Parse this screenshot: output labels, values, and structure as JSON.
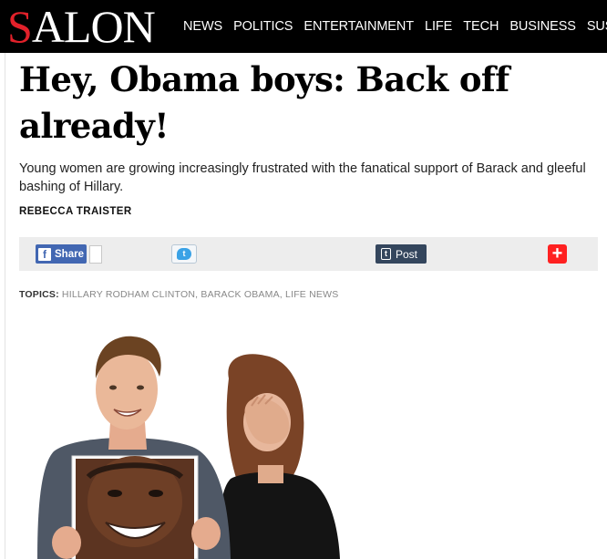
{
  "site": {
    "logo_first": "S",
    "logo_rest": "ALON",
    "logo_color": "#e2212a"
  },
  "nav": [
    {
      "label": "NEWS"
    },
    {
      "label": "POLITICS"
    },
    {
      "label": "ENTERTAINMENT"
    },
    {
      "label": "LIFE"
    },
    {
      "label": "TECH"
    },
    {
      "label": "BUSINESS"
    },
    {
      "label": "SUSTAINA"
    }
  ],
  "article": {
    "headline": "Hey, Obama boys: Back off already!",
    "dek": "Young women are growing increasingly frustrated with the fanatical support of Barack and gleeful bashing of Hillary.",
    "byline": "REBECCA TRAISTER"
  },
  "share": {
    "facebook_label": "Share",
    "facebook_color": "#4267b2",
    "twitter_color": "#3aa2e6",
    "tumblr_label": "Post",
    "tumblr_color": "#34465d",
    "plus_color": "#ff2121",
    "plus_symbol": "+"
  },
  "topics": {
    "label": "TOPICS:",
    "items": [
      "HILLARY RODHAM CLINTON",
      "BARACK OBAMA",
      "LIFE NEWS"
    ]
  },
  "hero_image": {
    "icon": "photo"
  }
}
